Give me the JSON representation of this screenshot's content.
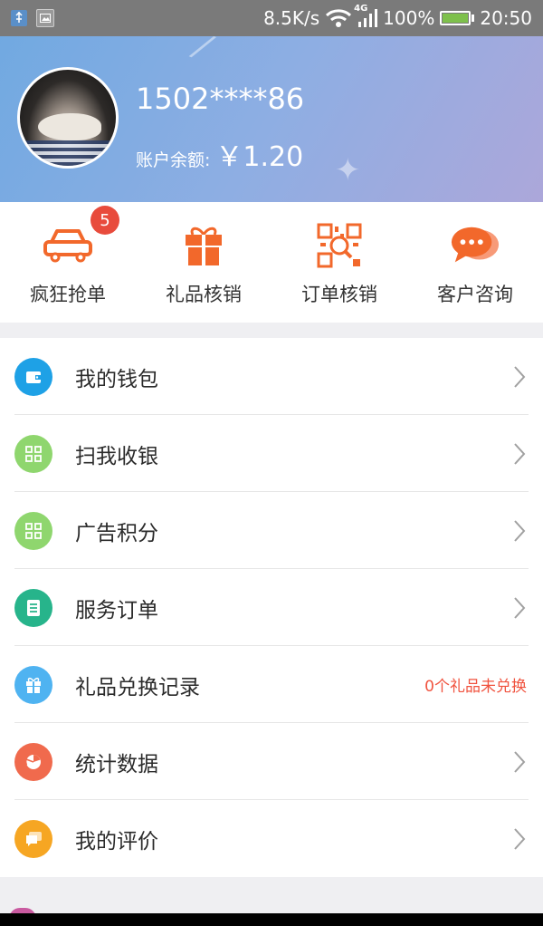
{
  "status_bar": {
    "net_speed": "8.5K/s",
    "network_type": "4G",
    "battery": "100%",
    "time": "20:50"
  },
  "profile": {
    "phone": "1502****86",
    "balance_label": "账户余额:",
    "balance_value": "￥1.20"
  },
  "quick_actions": [
    {
      "label": "疯狂抢单",
      "icon": "car-icon",
      "badge": "5"
    },
    {
      "label": "礼品核销",
      "icon": "gift-icon"
    },
    {
      "label": "订单核销",
      "icon": "qr-scan-icon"
    },
    {
      "label": "客户咨询",
      "icon": "chat-bubbles-icon"
    }
  ],
  "menu": [
    {
      "label": "我的钱包",
      "icon": "wallet-icon",
      "color": "#1ea1e6"
    },
    {
      "label": "扫我收银",
      "icon": "qr-code-icon",
      "color": "#8fd66e"
    },
    {
      "label": "广告积分",
      "icon": "qr-code-icon",
      "color": "#8fd66e"
    },
    {
      "label": "服务订单",
      "icon": "order-list-icon",
      "color": "#27b48b"
    },
    {
      "label": "礼品兑换记录",
      "icon": "gift-icon",
      "color": "#4fb3f1",
      "note": "0个礼品未兑换"
    },
    {
      "label": "统计数据",
      "icon": "pie-chart-icon",
      "color": "#f06a4d"
    },
    {
      "label": "我的评价",
      "icon": "comment-icon",
      "color": "#f6a623"
    }
  ],
  "colors": {
    "accent_orange": "#f2682b",
    "badge_red": "#e84b3c",
    "note_red": "#f0533f"
  }
}
